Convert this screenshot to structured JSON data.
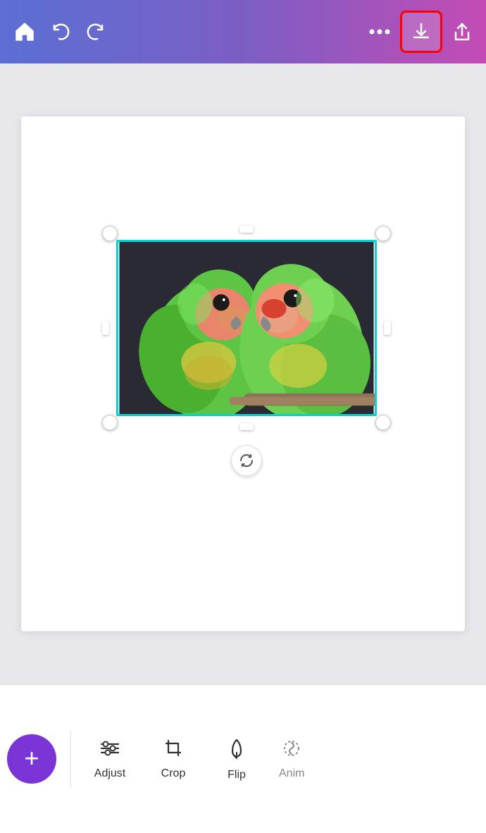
{
  "header": {
    "home_icon": "🏠",
    "undo_label": "undo",
    "redo_label": "redo",
    "more_label": "more",
    "download_label": "download",
    "share_label": "share"
  },
  "canvas": {
    "rotate_icon": "↺"
  },
  "toolbar": {
    "add_label": "+",
    "items": [
      {
        "label": "Adjust",
        "icon": "adjust"
      },
      {
        "label": "Crop",
        "icon": "crop"
      },
      {
        "label": "Flip",
        "icon": "flip"
      },
      {
        "label": "Anim",
        "icon": "anim"
      }
    ]
  }
}
